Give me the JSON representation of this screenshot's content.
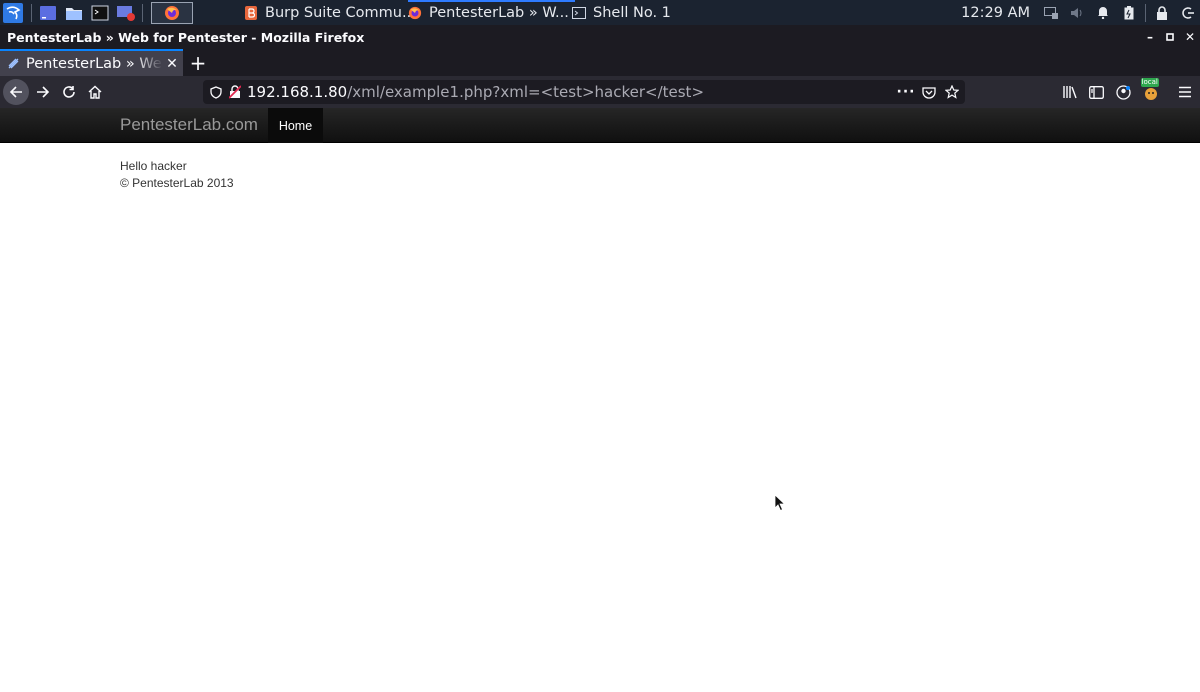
{
  "taskbar": {
    "tasks": [
      {
        "label": "Burp Suite Commu...",
        "icon": "burp-icon"
      },
      {
        "label": "PentesterLab » W...",
        "icon": "firefox-icon"
      },
      {
        "label": "Shell No. 1",
        "icon": "terminal-icon"
      }
    ],
    "clock": "12:29 AM"
  },
  "window": {
    "title": "PentesterLab » Web for Pentester - Mozilla Firefox"
  },
  "tabs": [
    {
      "label": "PentesterLab » Web for Pentester"
    }
  ],
  "navbar": {
    "url_host": "192.168.1.80",
    "url_path": "/xml/example1.php?xml=<test>hacker</test>",
    "extension_badge": "local"
  },
  "page": {
    "brand": "PentesterLab.com",
    "nav_items": [
      "Home"
    ],
    "content_line": "Hello hacker",
    "footer": "© PentesterLab 2013"
  },
  "colors": {
    "taskbar_bg": "#1b2330",
    "browser_chrome": "#1c1b22",
    "active_tab": "#42414d",
    "tab_accent": "#0a84ff",
    "site_nav": "#1b1b1b"
  }
}
